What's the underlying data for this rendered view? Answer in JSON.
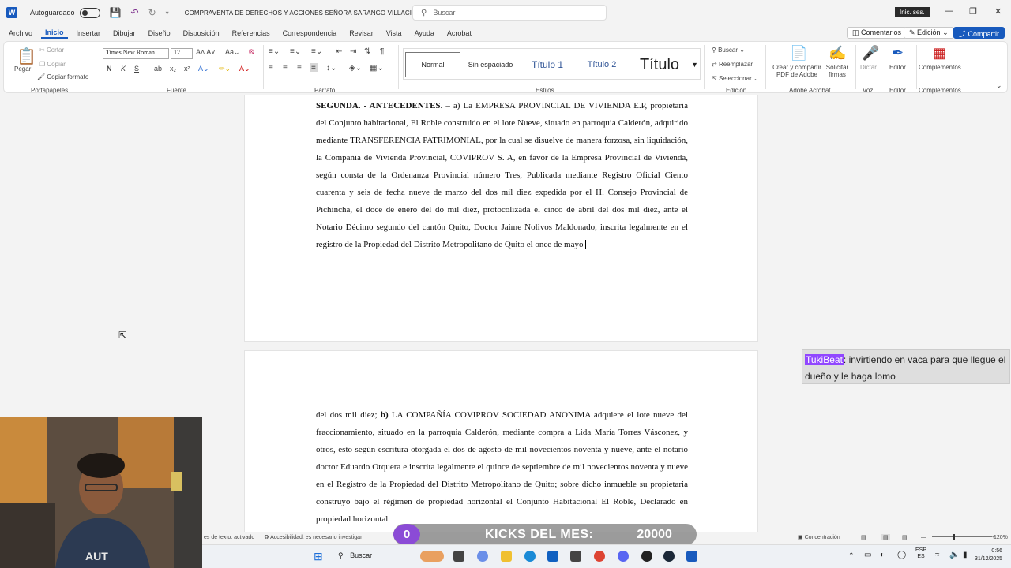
{
  "titlebar": {
    "app_icon_letter": "W",
    "autosave_label": "Autoguardado",
    "doc_title": "COMPRAVENTA DE DERECHOS Y ACCIONES SEÑORA SARANGO VILLACIS",
    "search_placeholder": "Buscar",
    "signin_label": "Inic. ses."
  },
  "tabs": [
    "Archivo",
    "Inicio",
    "Insertar",
    "Dibujar",
    "Diseño",
    "Disposición",
    "Referencias",
    "Correspondencia",
    "Revisar",
    "Vista",
    "Ayuda",
    "Acrobat"
  ],
  "active_tab": "Inicio",
  "tab_buttons": {
    "comments": "Comentarios",
    "editing": "Edición",
    "share": "Compartir"
  },
  "ribbon": {
    "clipboard": {
      "paste": "Pegar",
      "cut": "Cortar",
      "copy": "Copiar",
      "format_painter": "Copiar formato",
      "label": "Portapapeles"
    },
    "font": {
      "family": "Times New Roman",
      "size": "12",
      "label": "Fuente"
    },
    "paragraph": {
      "label": "Párrafo"
    },
    "styles": {
      "items": [
        "Normal",
        "Sin espaciado",
        "Título 1",
        "Título 2",
        "Título"
      ],
      "label": "Estilos"
    },
    "editing": {
      "find": "Buscar",
      "replace": "Reemplazar",
      "select": "Seleccionar",
      "label": "Edición"
    },
    "adobe": {
      "create_share": "Crear y compartir",
      "create_share_2": "PDF de Adobe",
      "request_sign": "Solicitar",
      "request_sign_2": "firmas",
      "label": "Adobe Acrobat"
    },
    "voice": {
      "dictate": "Dictar",
      "label": "Voz"
    },
    "editor": {
      "name": "Editor",
      "label": "Editor"
    },
    "addins": {
      "name": "Complementos",
      "label": "Complementos"
    }
  },
  "document": {
    "page1_heading": "SEGUNDA. - ANTECEDENTES",
    "page1_text": ". – a) La EMPRESA PROVINCIAL DE VIVIENDA E.P, propietaria del Conjunto habitacional, El Roble construido en el lote Nueve, situado en parroquia Calderón, adquirido mediante TRANSFERENCIA PATRIMONIAL, por la cual se disuelve de manera forzosa, sin liquidación, la Compañía de Vivienda Provincial, COVIPROV S. A, en favor de la Empresa Provincial de Vivienda, según consta de la Ordenanza Provincial número Tres, Publicada mediante Registro Oficial Ciento cuarenta y seis de fecha nueve de marzo del dos mil diez expedida por el H. Consejo Provincial de Pichincha, el doce de enero del do mil diez, protocolizada el cinco de abril del dos mil diez, ante el Notario Décimo segundo del cantón Quito, Doctor Jaime Nolivos Maldonado, inscrita legalmente en el registro de la Propiedad del Distrito Metropolitano de Quito el once de mayo",
    "page2_lead": "del dos mil diez; ",
    "page2_bold": "b)",
    "page2_text": " LA COMPAÑÍA COVIPROV SOCIEDAD ANONIMA adquiere el lote nueve del fraccionamiento, situado en la parroquia Calderón, mediante compra a Lida María Torres Vásconez, y otros, esto según escritura otorgada el dos de agosto de mil novecientos noventa y nueve, ante el notario doctor Eduardo Orquera e inscrita legalmente el quince de septiembre de mil novecientos noventa y nueve en el Registro de la Propiedad del Distrito Metropolitano de Quito; sobre dicho inmueble su propietaria construyo bajo el régimen de propiedad horizontal el Conjunto Habitacional El Roble, Declarado en propiedad horizontal"
  },
  "chat": {
    "user": "TukiBeat",
    "message": ": invirtiendo en vaca para que llegue el dueño y le haga lomo"
  },
  "statusbar": {
    "text_prediction": "es de texto: activado",
    "accessibility": "Accesibilidad: es necesario investigar",
    "focus": "Concentración",
    "zoom": "120%"
  },
  "kicks": {
    "count": "0",
    "label": "KICKS DEL MES:",
    "goal": "20000"
  },
  "taskbar": {
    "search": "Buscar",
    "lang_1": "ESP",
    "lang_2": "ES",
    "time": "0:56",
    "date": "31/12/2025"
  },
  "colors": {
    "accent": "#185abd",
    "kick_purple": "#8b4bd6",
    "chat_user": "#9147ff"
  }
}
